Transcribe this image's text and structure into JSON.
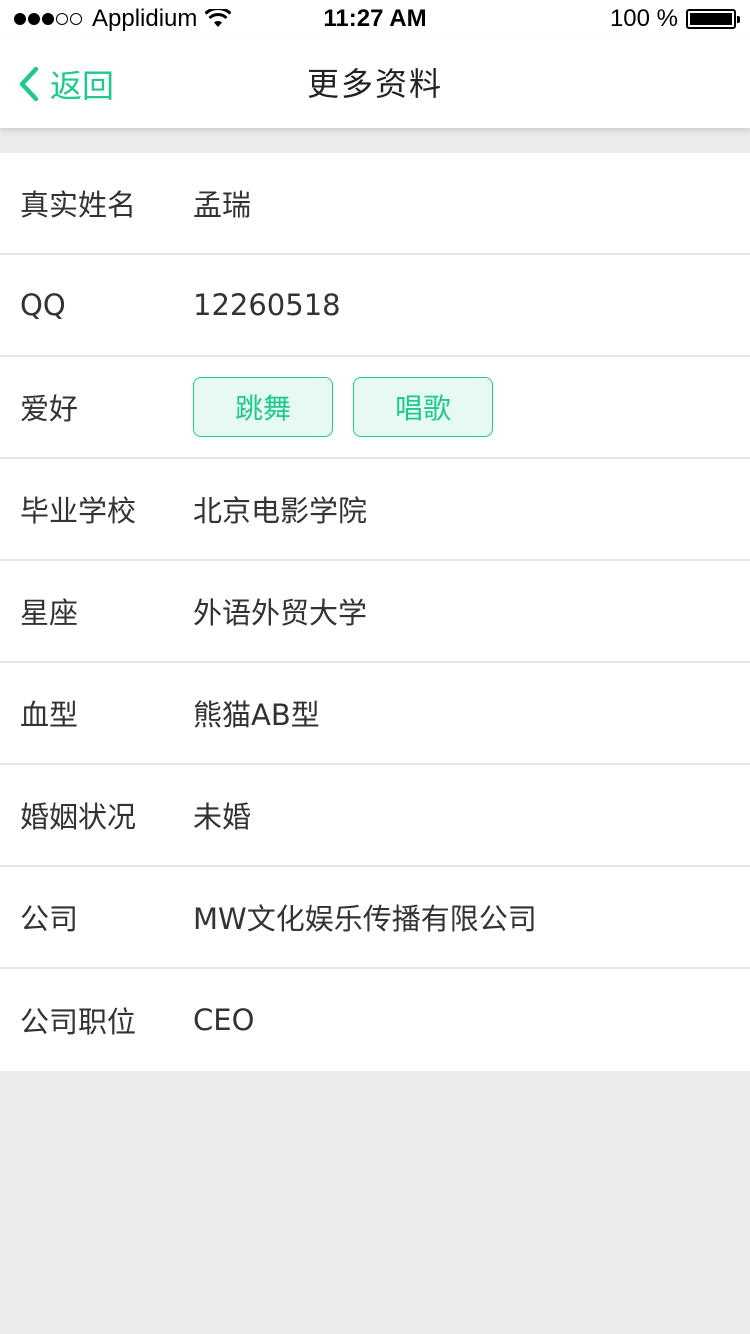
{
  "status_bar": {
    "carrier": "Applidium",
    "time": "11:27 AM",
    "battery": "100 %",
    "battery_level": 1.0,
    "signal_bars": 3,
    "signal_total": 5
  },
  "nav": {
    "back_label": "返回",
    "title": "更多资料",
    "accent_color": "#1fc98e"
  },
  "profile": {
    "real_name": {
      "label": "真实姓名",
      "value": "孟瑞"
    },
    "qq": {
      "label": "QQ",
      "value": "12260518"
    },
    "hobbies": {
      "label": "爱好",
      "tags": [
        "跳舞",
        "唱歌"
      ]
    },
    "school": {
      "label": "毕业学校",
      "value": "北京电影学院"
    },
    "constellation": {
      "label": "星座",
      "value": "外语外贸大学"
    },
    "blood_type": {
      "label": "血型",
      "value": "熊猫AB型"
    },
    "marital_status": {
      "label": "婚姻状况",
      "value": "未婚"
    },
    "company": {
      "label": "公司",
      "value": "MW文化娱乐传播有限公司"
    },
    "position": {
      "label": "公司职位",
      "value": "CEO"
    }
  }
}
